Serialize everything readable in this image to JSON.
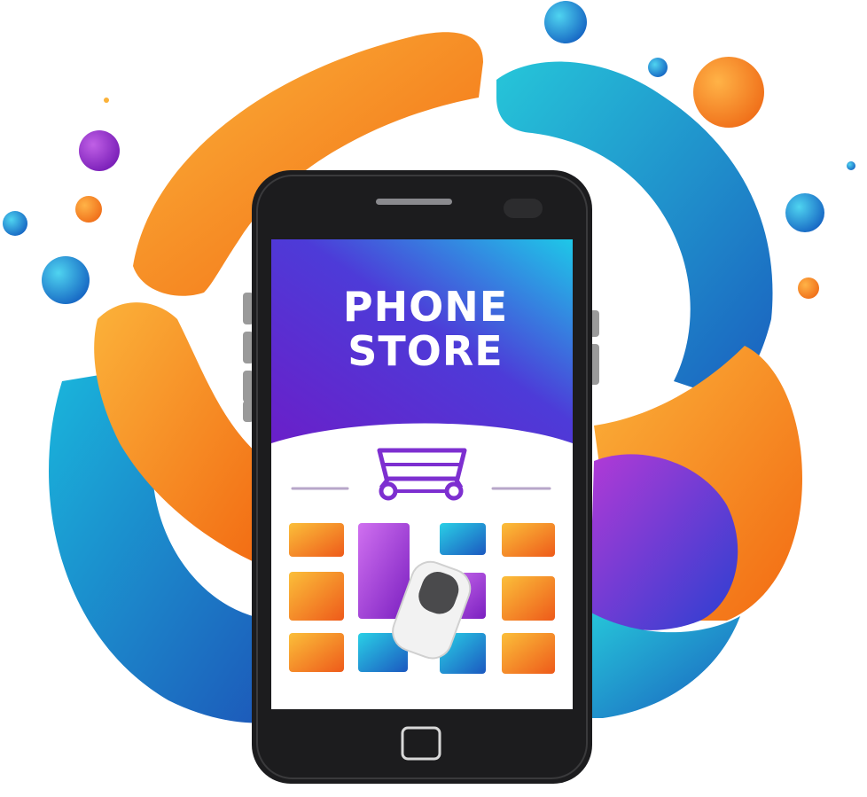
{
  "logo": {
    "title_line1": "PHONE",
    "title_line2": "STORE",
    "icon": "shopping-cart-icon"
  },
  "colors": {
    "orange": "#f7821c",
    "orange_light": "#fbb23a",
    "teal": "#1aa7c4",
    "blue": "#1d6fd0",
    "purple": "#8a2be2",
    "phone_body": "#1c1c1e",
    "screen_top_start": "#6a1fc9",
    "screen_top_end": "#1ec8e8"
  }
}
